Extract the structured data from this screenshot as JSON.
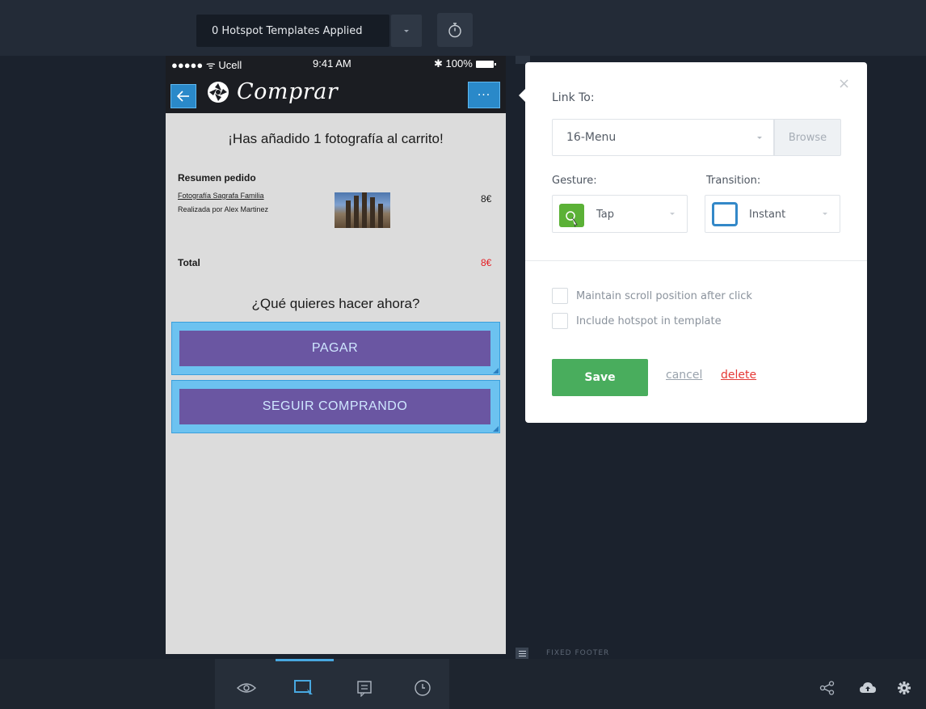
{
  "topbar": {
    "templates_label": "0 Hotspot Templates Applied",
    "dropdown_icon": "caret-down-icon",
    "timer_icon": "stopwatch-icon"
  },
  "phone": {
    "status": {
      "carrier": "●●●●● ᯤ Ucell",
      "time": "9:41 AM",
      "battery": "✱ 100%"
    },
    "nav": {
      "title": "Comprar",
      "back_icon": "back-arrow-icon",
      "menu_label": "···"
    },
    "added_title": "¡Has añadido 1 fotografía al carrito!",
    "summary_title": "Resumen pedido",
    "item": {
      "name": "Fotografía Sagrafa Familia",
      "author": "Realizada por Alex Martinez",
      "price": "8€"
    },
    "total_label": "Total",
    "total_value": "8€",
    "question": "¿Qué quieres hacer ahora?",
    "buttons": {
      "pay": "PAGAR",
      "continue": "SEGUIR COMPRANDO"
    }
  },
  "footer_marker_label": "FIXED FOOTER",
  "popover": {
    "close_label": "×",
    "link_to_label": "Link To:",
    "link_value": "16-Menu",
    "browse_label": "Browse",
    "gesture_label": "Gesture:",
    "gesture_value": "Tap",
    "transition_label": "Transition:",
    "transition_value": "Instant",
    "checkbox_scroll": "Maintain scroll position after click",
    "checkbox_template": "Include hotspot in template",
    "save_label": "Save",
    "cancel_label": "cancel",
    "delete_label": "delete"
  },
  "toolbar": {
    "tools": [
      "preview-eye-icon",
      "hotspot-build-icon",
      "comments-icon",
      "history-clock-icon"
    ],
    "right_tools": [
      "share-icon",
      "cloud-icon",
      "settings-gear-icon"
    ]
  },
  "colors": {
    "accent": "#2a89c9",
    "save_green": "#49ad5d",
    "delete_red": "#e53935",
    "purple_button": "#6a56a2",
    "hotspot_blue": "#6cc2f0"
  }
}
